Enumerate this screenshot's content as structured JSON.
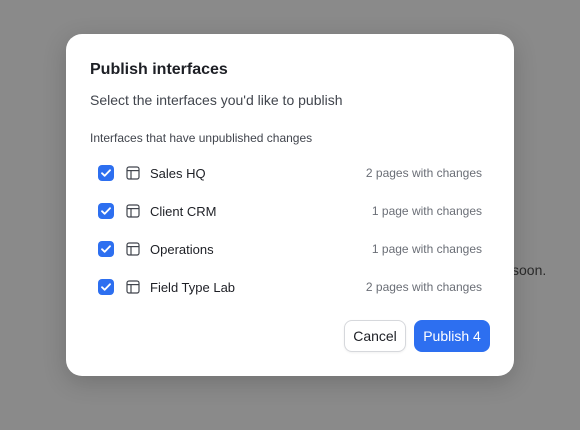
{
  "background": {
    "partial_text": "soon."
  },
  "modal": {
    "title": "Publish interfaces",
    "subtitle": "Select the interfaces you'd like to publish",
    "section_label": "Interfaces that have unpublished changes",
    "interfaces": [
      {
        "name": "Sales HQ",
        "changes": "2 pages with changes",
        "checked": true
      },
      {
        "name": "Client CRM",
        "changes": "1 page with changes",
        "checked": true
      },
      {
        "name": "Operations",
        "changes": "1 page with changes",
        "checked": true
      },
      {
        "name": "Field Type Lab",
        "changes": "2 pages with changes",
        "checked": true
      }
    ],
    "cancel_label": "Cancel",
    "publish_label": "Publish 4"
  },
  "icons": {
    "checkbox": "checkmark-icon",
    "interface": "layout-icon"
  },
  "colors": {
    "accent": "#2d6ff0",
    "backdrop": "#8a8a8a"
  }
}
